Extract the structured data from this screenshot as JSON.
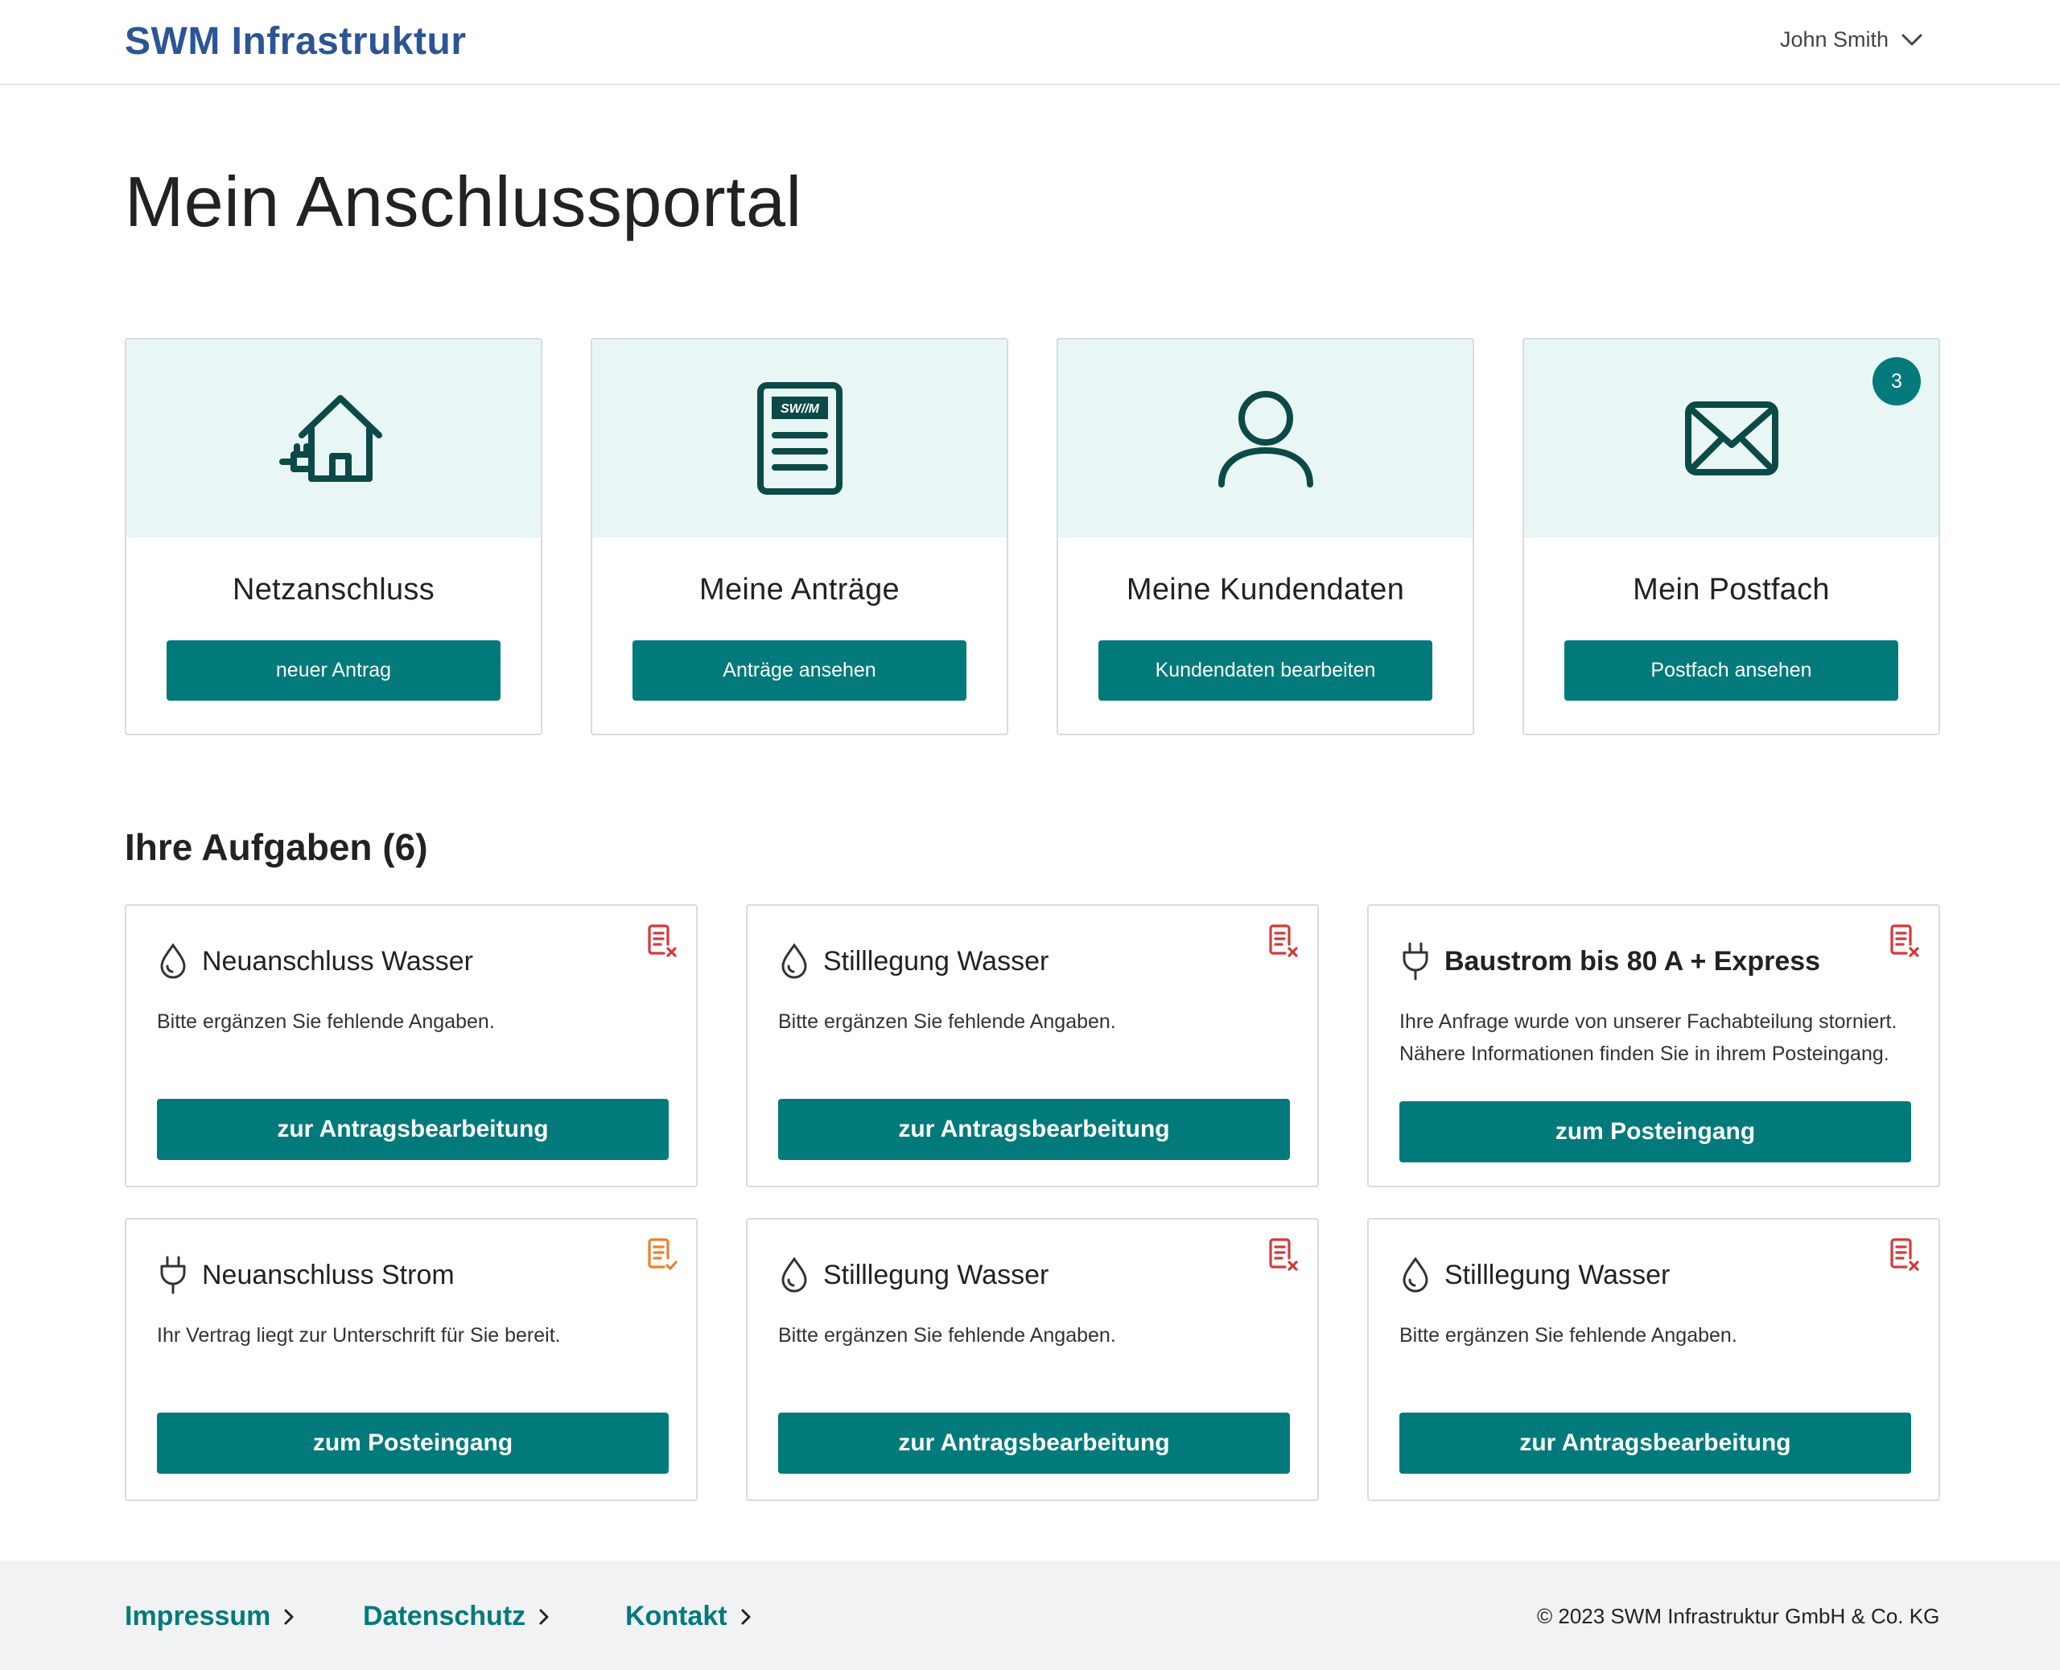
{
  "header": {
    "logo": "SWM Infrastruktur",
    "user_name": "John Smith"
  },
  "page_title": "Mein Anschlussportal",
  "tiles": [
    {
      "title": "Netzanschluss",
      "button": "neuer Antrag",
      "icon": "house-plug-icon"
    },
    {
      "title": "Meine Anträge",
      "button": "Anträge ansehen",
      "icon": "document-icon",
      "doc_label": "SW//M"
    },
    {
      "title": "Meine Kundendaten",
      "button": "Kundendaten bearbeiten",
      "icon": "person-icon"
    },
    {
      "title": "Mein Postfach",
      "button": "Postfach ansehen",
      "icon": "envelope-icon",
      "badge": "3"
    }
  ],
  "tasks_section": {
    "title": "Ihre Aufgaben (6)",
    "tasks": [
      {
        "title": "Neuanschluss Wasser",
        "text": "Bitte ergänzen Sie fehlende Angaben.",
        "button": "zur Antragsbearbeitung",
        "type_icon": "water-drop-icon",
        "status_icon": "document-error-icon"
      },
      {
        "title": "Stilllegung Wasser",
        "text": "Bitte ergänzen Sie fehlende Angaben.",
        "button": "zur Antragsbearbeitung",
        "type_icon": "water-drop-icon",
        "status_icon": "document-error-icon"
      },
      {
        "title": "Baustrom bis 80 A + Express",
        "text_line1": "Ihre Anfrage wurde von unserer Fachabteilung storniert.",
        "text_line2": "Nähere Informationen finden Sie in ihrem Posteingang.",
        "button": "zum Posteingang",
        "type_icon": "plug-icon",
        "status_icon": "document-error-icon"
      },
      {
        "title": "Neuanschluss Strom",
        "text": "Ihr Vertrag liegt zur Unterschrift für Sie bereit.",
        "button": "zum Posteingang",
        "type_icon": "plug-icon",
        "status_icon": "document-check-icon"
      },
      {
        "title": "Stilllegung Wasser",
        "text": "Bitte ergänzen Sie fehlende Angaben.",
        "button": "zur Antragsbearbeitung",
        "type_icon": "water-drop-icon",
        "status_icon": "document-error-icon"
      },
      {
        "title": "Stilllegung Wasser",
        "text": "Bitte ergänzen Sie fehlende Angaben.",
        "button": "zur Antragsbearbeitung",
        "type_icon": "water-drop-icon",
        "status_icon": "document-error-icon"
      }
    ]
  },
  "footer": {
    "links": [
      "Impressum",
      "Datenschutz",
      "Kontakt"
    ],
    "copyright": "© 2023 SWM Infrastruktur GmbH & Co. KG"
  },
  "colors": {
    "brand_blue": "#2b5595",
    "primary_teal": "#027a7b",
    "icon_dark_teal": "#0b4a47",
    "tile_bg": "#e9f6f6",
    "status_error": "#d33a3a",
    "status_pending": "#e8812f"
  }
}
